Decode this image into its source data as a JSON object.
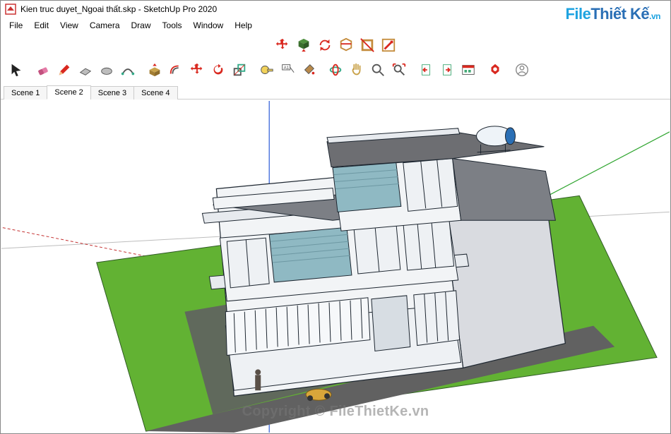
{
  "window": {
    "title": "Kien truc duyet_Ngoai thất.skp - SketchUp Pro 2020"
  },
  "menu": {
    "items": [
      "File",
      "Edit",
      "View",
      "Camera",
      "Draw",
      "Tools",
      "Window",
      "Help"
    ]
  },
  "scenes": {
    "tabs": [
      "Scene 1",
      "Scene 2",
      "Scene 3",
      "Scene 4"
    ],
    "active_index": 1
  },
  "watermark": {
    "center": "Copyright © FileThietKe.vn",
    "logo_part1": "File",
    "logo_part2": "Thiết Kế",
    "logo_part3": ".vn"
  },
  "toolbar_top": {
    "icons": [
      "move-4way-icon",
      "extrude-down-icon",
      "sync-icon",
      "section-cut-icon",
      "section-plane-icon",
      "section-view-icon"
    ]
  },
  "toolbar_main": {
    "icons": [
      "select-arrow-icon",
      "eraser-icon",
      "pencil-icon",
      "rectangle-icon",
      "circle-icon",
      "arc-icon",
      "push-pull-icon",
      "offset-icon",
      "move-icon",
      "rotate-icon",
      "scale-icon",
      "tape-measure-icon",
      "text-label-icon",
      "paint-bucket-icon",
      "orbit-icon",
      "pan-icon",
      "zoom-icon",
      "zoom-extents-icon",
      "component-prev-icon",
      "component-next-icon",
      "component-browser-icon",
      "extension-warehouse-icon",
      "user-account-icon"
    ]
  },
  "colors": {
    "grass": "#62b233",
    "road": "#616161",
    "wall_light": "#f2f4f6",
    "wall_blue": "#8fb9c3",
    "roof": "#6d6e72",
    "axis_red": "#c43131",
    "axis_green": "#2fa52f",
    "axis_blue": "#2a5bd7"
  }
}
